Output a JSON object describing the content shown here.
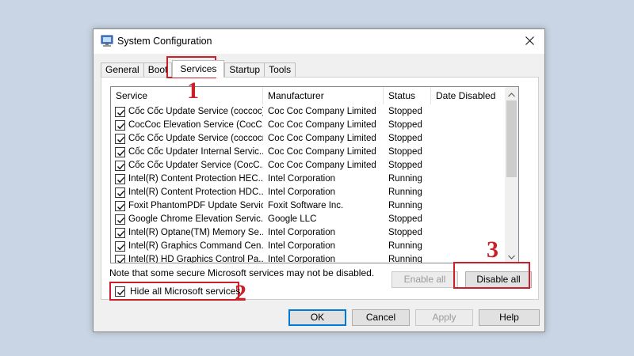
{
  "window": {
    "title": "System Configuration",
    "app_icon": "monitor-icon",
    "close_icon": "close-icon"
  },
  "tabs": [
    "General",
    "Boot",
    "Services",
    "Startup",
    "Tools"
  ],
  "active_tab": "Services",
  "list": {
    "columns": [
      "Service",
      "Manufacturer",
      "Status",
      "Date Disabled"
    ],
    "rows": [
      {
        "checked": true,
        "service": "Cốc Cốc Update Service (coccoc)",
        "manufacturer": "Coc Coc Company Limited",
        "status": "Stopped"
      },
      {
        "checked": true,
        "service": "CocCoc Elevation Service (CocC...",
        "manufacturer": "Coc Coc Company Limited",
        "status": "Stopped"
      },
      {
        "checked": true,
        "service": "Cốc Cốc Update Service (coccocm)",
        "manufacturer": "Coc Coc Company Limited",
        "status": "Stopped"
      },
      {
        "checked": true,
        "service": "Cốc Cốc Updater Internal Servic...",
        "manufacturer": "Coc Coc Company Limited",
        "status": "Stopped"
      },
      {
        "checked": true,
        "service": "Cốc Cốc Updater Service (CocC...",
        "manufacturer": "Coc Coc Company Limited",
        "status": "Stopped"
      },
      {
        "checked": true,
        "service": "Intel(R) Content Protection HEC...",
        "manufacturer": "Intel Corporation",
        "status": "Running"
      },
      {
        "checked": true,
        "service": "Intel(R) Content Protection HDC...",
        "manufacturer": "Intel Corporation",
        "status": "Running"
      },
      {
        "checked": true,
        "service": "Foxit PhantomPDF Update Service",
        "manufacturer": "Foxit Software Inc.",
        "status": "Running"
      },
      {
        "checked": true,
        "service": "Google Chrome Elevation Servic...",
        "manufacturer": "Google LLC",
        "status": "Stopped"
      },
      {
        "checked": true,
        "service": "Intel(R) Optane(TM) Memory Se...",
        "manufacturer": "Intel Corporation",
        "status": "Stopped"
      },
      {
        "checked": true,
        "service": "Intel(R) Graphics Command Cen...",
        "manufacturer": "Intel Corporation",
        "status": "Running"
      },
      {
        "checked": true,
        "service": "Intel(R) HD Graphics Control Pa...",
        "manufacturer": "Intel Corporation",
        "status": "Running"
      }
    ]
  },
  "note": "Note that some secure Microsoft services may not be disabled.",
  "hide_ms": {
    "label": "Hide all Microsoft services",
    "checked": true
  },
  "buttons": {
    "enable_all": "Enable all",
    "disable_all": "Disable all",
    "ok": "OK",
    "cancel": "Cancel",
    "apply": "Apply",
    "help": "Help"
  },
  "annotations": [
    "1",
    "2",
    "3"
  ],
  "colors": {
    "highlight": "#c9202a",
    "default_button_border": "#0078d7",
    "backdrop": "#c9d5e4"
  }
}
